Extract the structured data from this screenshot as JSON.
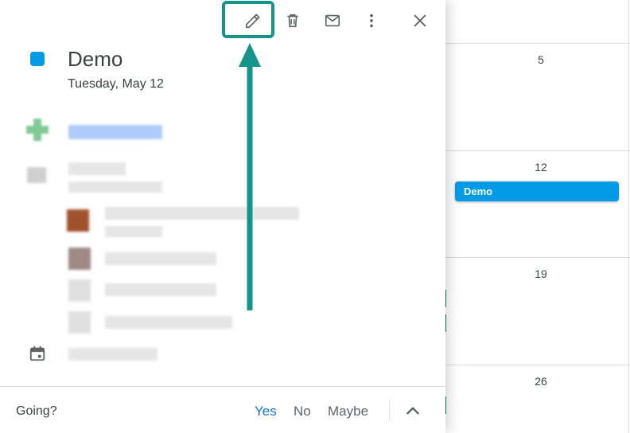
{
  "calendar": {
    "days": [
      "5",
      "12",
      "19",
      "26"
    ],
    "event_chip": "Demo"
  },
  "event": {
    "title": "Demo",
    "date": "Tuesday, May 12"
  },
  "toolbar": {
    "icons": [
      "pencil-icon",
      "trash-icon",
      "mail-icon",
      "more-vert-icon",
      "close-icon"
    ]
  },
  "footer": {
    "going_label": "Going?",
    "yes": "Yes",
    "no": "No",
    "maybe": "Maybe"
  },
  "colors": {
    "event": "#039be5",
    "highlight": "#15958a",
    "accent": "#1a73e8"
  }
}
